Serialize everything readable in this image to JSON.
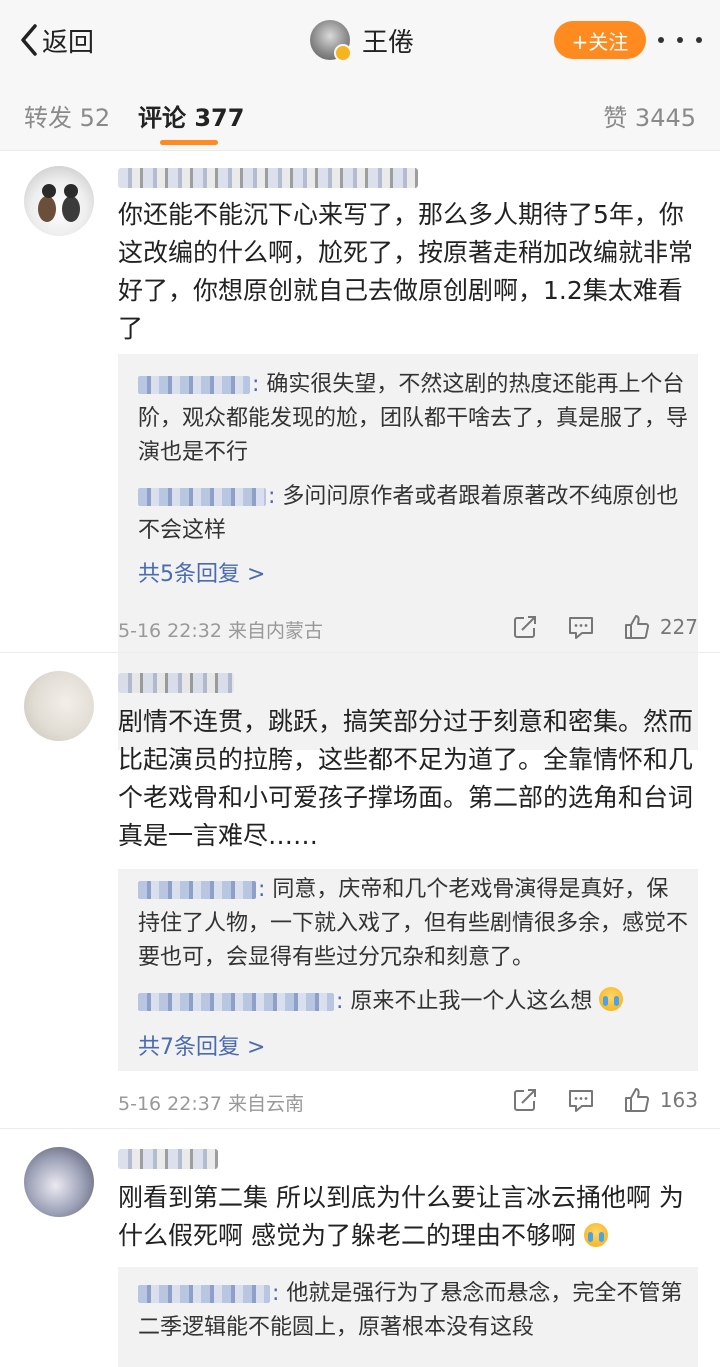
{
  "header": {
    "back_label": "返回",
    "user_name": "王倦",
    "follow_label": "+关注"
  },
  "tabs": {
    "repost": {
      "label": "转发",
      "count": "52"
    },
    "comment": {
      "label": "评论",
      "count": "377"
    },
    "like": {
      "label": "赞",
      "count": "3445"
    }
  },
  "comments": [
    {
      "text": "你还能不能沉下心来写了，那么多人期待了5年，你这改编的什么啊，尬死了，按原著走稍加改编就非常好了，你想原创就自己去做原创剧啊，1.2集太难看了",
      "replies": [
        {
          "text": "确实很失望，不然这剧的热度还能再上个台阶，观众都能发现的尬，团队都干啥去了，真是服了，导演也是不行"
        },
        {
          "text": "多问问原作者或者跟着原著改不纯原创也不会这样"
        }
      ],
      "more_replies": "共5条回复 >",
      "time": "5-16 22:32",
      "location": "来自内蒙古",
      "likes": "227"
    },
    {
      "text": "剧情不连贯，跳跃，搞笑部分过于刻意和密集。然而比起演员的拉胯，这些都不足为道了。全靠情怀和几个老戏骨和小可爱孩子撑场面。第二部的选角和台词真是一言难尽……",
      "replies": [
        {
          "text": "同意，庆帝和几个老戏骨演得是真好，保持住了人物，一下就入戏了，但有些剧情很多余，感觉不要也可，会显得有些过分冗杂和刻意了。"
        },
        {
          "text": "原来不止我一个人这么想"
        }
      ],
      "more_replies": "共7条回复 >",
      "time": "5-16 22:37",
      "location": "来自云南",
      "likes": "163"
    },
    {
      "text": "刚看到第二集 所以到底为什么要让言冰云捅他啊 为什么假死啊 感觉为了躲老二的理由不够啊",
      "replies": [
        {
          "text": "他就是强行为了悬念而悬念，完全不管第二季逻辑能不能圆上，原著根本没有这段"
        }
      ]
    }
  ],
  "colors": {
    "accent": "#ff8a1f",
    "link": "#4a6bb0",
    "muted": "#999999"
  }
}
